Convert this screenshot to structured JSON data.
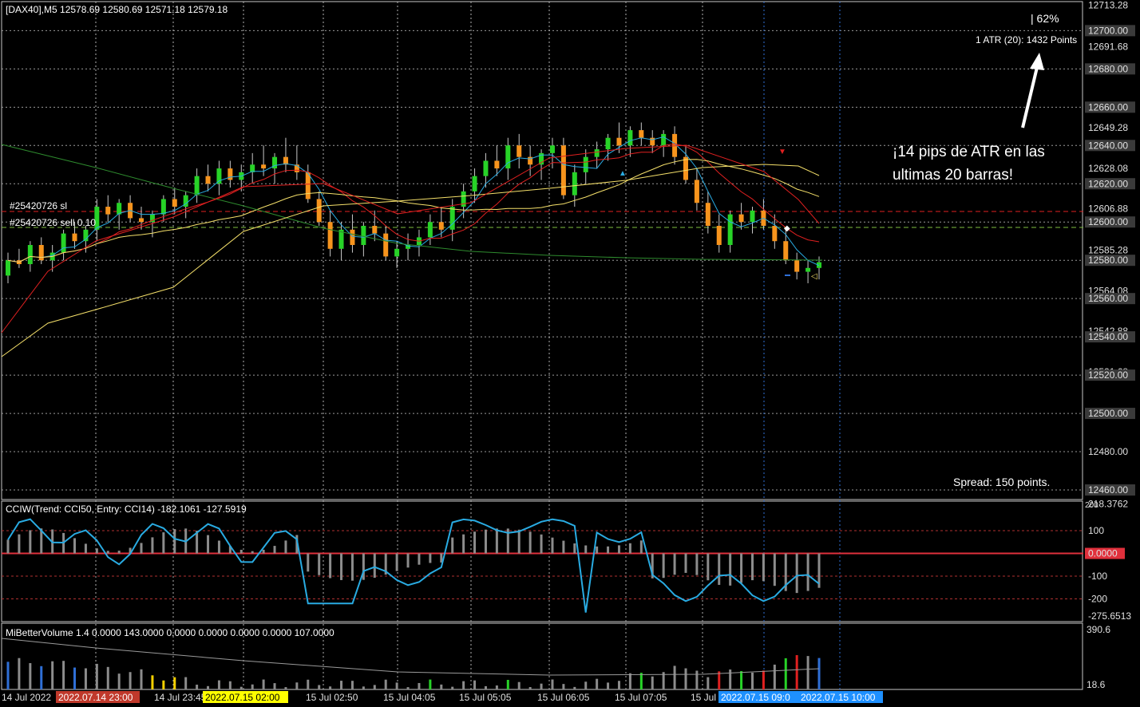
{
  "header": {
    "symbol_info": "[DAX40],M5  12578.69 12580.69 12571.18 12579.18",
    "cci_info": "CCIW(Trend: CCI50, Entry: CCI14) -182.1061 -127.5919",
    "vol_info": "MiBetterVolume 1.4 0.0000 143.0000 0.0000 0.0000 0.0000 0.0000 107.0000"
  },
  "overlay": {
    "percent": "| 62%",
    "atr": "1 ATR (20): 1432 Points",
    "annotation_line1": "¡14 pips de ATR en las",
    "annotation_line2": "ultimas 20 barras!",
    "spread": "Spread: 150 points.",
    "order1": "#25420726 sl",
    "order2": "#25420726 sell 0.10"
  },
  "price_axis": {
    "labels": [
      "12713.28",
      "12700.00",
      "12691.68",
      "12680.00",
      "12660.00",
      "12649.28",
      "12640.00",
      "12628.08",
      "12620.00",
      "12606.88",
      "12600.00",
      "12585.28",
      "12580.00",
      "12564.08",
      "12560.00",
      "12542.88",
      "12540.00",
      "12521.68",
      "12520.00",
      "12500.00",
      "12480.00",
      "12460.00"
    ],
    "boxed": [
      "12700.00",
      "12680.00",
      "12660.00",
      "12640.00",
      "12620.00",
      "12600.00",
      "12580.00",
      "12560.00",
      "12540.00",
      "12520.00",
      "12500.00",
      "12460.00"
    ],
    "plain": [
      "12713.28",
      "12691.68",
      "12649.28",
      "12628.08",
      "12606.88",
      "12585.28",
      "12564.08",
      "12542.88",
      "12521.68",
      "12480.00"
    ]
  },
  "cci_axis": {
    "labels": [
      "218.3762",
      "100",
      "0.0000",
      "-100",
      "-200",
      "-275.6513"
    ],
    "extra": "200"
  },
  "vol_axis": {
    "labels": [
      "390.6",
      "18.6"
    ]
  },
  "time_axis": {
    "labels": [
      "14 Jul 2022",
      "14 Jul 23:45",
      "15 Jul 02:50",
      "15 Jul 04:05",
      "15 Jul 05:05",
      "15 Jul 06:05",
      "15 Jul 07:05",
      "15 Jul"
    ],
    "highlights": [
      {
        "text": "2022.07.14 23:00",
        "color": "#c0392b"
      },
      {
        "text": "2022.07.15 02:00",
        "color": "#ffff00"
      },
      {
        "text": "2022.07.15 09:0",
        "color": "#1e90ff"
      },
      {
        "text": "2022.07.15 10:00",
        "color": "#1e90ff"
      }
    ]
  },
  "colors": {
    "bull": "#27d327",
    "bear": "#f7941d",
    "ma_fast": "#29abe2",
    "ma_red": "#e02020",
    "ma_yellow": "#f5e06a",
    "ma_green": "#2e8b2e",
    "cci_line": "#29abe2",
    "cci_hist": "#8c8c8c",
    "zero_line": "#e0303c",
    "grid": "#bdbdbd"
  },
  "chart_data": {
    "type": "candlestick",
    "candles_ohlc": [
      [
        12572,
        12584,
        12568,
        12580
      ],
      [
        12580,
        12586,
        12576,
        12578
      ],
      [
        12578,
        12590,
        12574,
        12588
      ],
      [
        12588,
        12592,
        12578,
        12580
      ],
      [
        12580,
        12588,
        12574,
        12584
      ],
      [
        12584,
        12596,
        12580,
        12594
      ],
      [
        12594,
        12600,
        12586,
        12590
      ],
      [
        12590,
        12598,
        12584,
        12596
      ],
      [
        12596,
        12612,
        12590,
        12608
      ],
      [
        12608,
        12614,
        12600,
        12604
      ],
      [
        12604,
        12612,
        12596,
        12610
      ],
      [
        12610,
        12614,
        12600,
        12602
      ],
      [
        12602,
        12608,
        12596,
        12600
      ],
      [
        12600,
        12606,
        12592,
        12604
      ],
      [
        12604,
        12614,
        12600,
        12612
      ],
      [
        12612,
        12618,
        12604,
        12608
      ],
      [
        12608,
        12616,
        12602,
        12614
      ],
      [
        12614,
        12628,
        12610,
        12624
      ],
      [
        12624,
        12630,
        12616,
        12620
      ],
      [
        12620,
        12632,
        12614,
        12628
      ],
      [
        12628,
        12632,
        12618,
        12622
      ],
      [
        12622,
        12630,
        12616,
        12626
      ],
      [
        12626,
        12636,
        12620,
        12630
      ],
      [
        12630,
        12640,
        12624,
        12628
      ],
      [
        12628,
        12636,
        12620,
        12634
      ],
      [
        12634,
        12644,
        12626,
        12630
      ],
      [
        12630,
        12640,
        12622,
        12626
      ],
      [
        12626,
        12630,
        12610,
        12612
      ],
      [
        12612,
        12616,
        12598,
        12600
      ],
      [
        12600,
        12606,
        12582,
        12586
      ],
      [
        12586,
        12600,
        12580,
        12596
      ],
      [
        12596,
        12604,
        12584,
        12588
      ],
      [
        12588,
        12600,
        12582,
        12598
      ],
      [
        12598,
        12606,
        12590,
        12594
      ],
      [
        12594,
        12598,
        12580,
        12582
      ],
      [
        12582,
        12590,
        12576,
        12586
      ],
      [
        12586,
        12594,
        12580,
        12588
      ],
      [
        12588,
        12596,
        12582,
        12592
      ],
      [
        12592,
        12604,
        12588,
        12600
      ],
      [
        12600,
        12608,
        12592,
        12596
      ],
      [
        12596,
        12612,
        12590,
        12608
      ],
      [
        12608,
        12620,
        12602,
        12616
      ],
      [
        12616,
        12628,
        12610,
        12624
      ],
      [
        12624,
        12636,
        12618,
        12632
      ],
      [
        12632,
        12640,
        12624,
        12628
      ],
      [
        12628,
        12644,
        12622,
        12640
      ],
      [
        12640,
        12646,
        12628,
        12634
      ],
      [
        12634,
        12640,
        12624,
        12630
      ],
      [
        12630,
        12638,
        12622,
        12636
      ],
      [
        12636,
        12644,
        12628,
        12640
      ],
      [
        12640,
        12644,
        12612,
        12614
      ],
      [
        12614,
        12630,
        12608,
        12626
      ],
      [
        12626,
        12638,
        12620,
        12634
      ],
      [
        12634,
        12642,
        12628,
        12638
      ],
      [
        12638,
        12646,
        12632,
        12644
      ],
      [
        12644,
        12652,
        12636,
        12640
      ],
      [
        12640,
        12650,
        12634,
        12648
      ],
      [
        12648,
        12652,
        12640,
        12644
      ],
      [
        12644,
        12648,
        12636,
        12640
      ],
      [
        12640,
        12648,
        12634,
        12646
      ],
      [
        12646,
        12650,
        12630,
        12634
      ],
      [
        12634,
        12640,
        12620,
        12622
      ],
      [
        12622,
        12628,
        12606,
        12610
      ],
      [
        12610,
        12616,
        12594,
        12598
      ],
      [
        12598,
        12604,
        12584,
        12588
      ],
      [
        12588,
        12606,
        12584,
        12604
      ],
      [
        12604,
        12610,
        12596,
        12600
      ],
      [
        12600,
        12608,
        12594,
        12606
      ],
      [
        12606,
        12612,
        12596,
        12598
      ],
      [
        12598,
        12604,
        12586,
        12590
      ],
      [
        12590,
        12596,
        12578,
        12580
      ],
      [
        12580,
        12584,
        12570,
        12574
      ],
      [
        12574,
        12580,
        12568,
        12576
      ],
      [
        12576,
        12582,
        12570,
        12579
      ]
    ]
  }
}
